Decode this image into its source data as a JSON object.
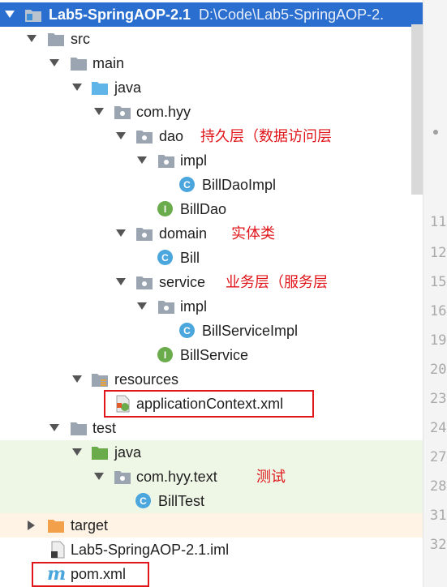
{
  "project": {
    "name": "Lab5-SpringAOP-2.1",
    "path": "D:\\Code\\Lab5-SpringAOP-2."
  },
  "tree": {
    "src": "src",
    "main": "main",
    "java": "java",
    "com_hyy": "com.hyy",
    "dao": "dao",
    "dao_impl": "impl",
    "bill_dao_impl": "BillDaoImpl",
    "bill_dao": "BillDao",
    "domain": "domain",
    "bill": "Bill",
    "service": "service",
    "service_impl": "impl",
    "bill_service_impl": "BillServiceImpl",
    "bill_service": "BillService",
    "resources": "resources",
    "app_context": "applicationContext.xml",
    "test": "test",
    "test_java": "java",
    "com_hyy_text": "com.hyy.text",
    "bill_test": "BillTest",
    "target": "target",
    "iml": "Lab5-SpringAOP-2.1.iml",
    "pom": "pom.xml"
  },
  "annotations": {
    "dao": "持久层（数据访问层",
    "domain": "实体类",
    "service": "业务层（服务层",
    "test": "测试"
  },
  "line_numbers": [
    "11",
    "12",
    "15",
    "16",
    "19",
    "20",
    "23",
    "24",
    "27",
    "28",
    "31",
    "32"
  ],
  "colors": {
    "selection": "#2a6fd0",
    "annotation_red": "#e0161b",
    "folder_gray": "#9aa5b1",
    "class_blue": "#4aa6dc",
    "interface_green": "#6aab4c"
  }
}
